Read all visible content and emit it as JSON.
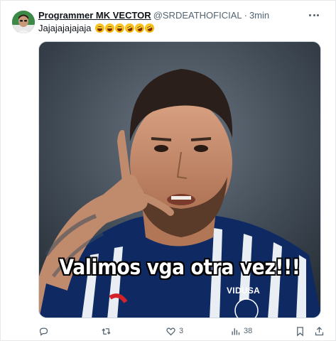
{
  "tweet": {
    "display_name": "Programmer MK VECTOR",
    "handle": "@SRDEATHOFICIAL",
    "separator": "·",
    "time": "3min",
    "text": "Jajajajajajaja",
    "emojis": [
      "grinning-sweat",
      "grinning-sweat",
      "grinning-sweat",
      "rolling-laughing",
      "rolling-laughing",
      "rolling-laughing"
    ]
  },
  "media": {
    "caption": "Valimos vga otra vez!!!",
    "jersey_sponsor": "VIDUSA"
  },
  "actions": {
    "reply_count": "",
    "retweet_count": "",
    "like_count": "3",
    "views_count": "38"
  },
  "colors": {
    "text_primary": "#0f1419",
    "text_secondary": "#536471",
    "border": "#e6e9ec"
  }
}
